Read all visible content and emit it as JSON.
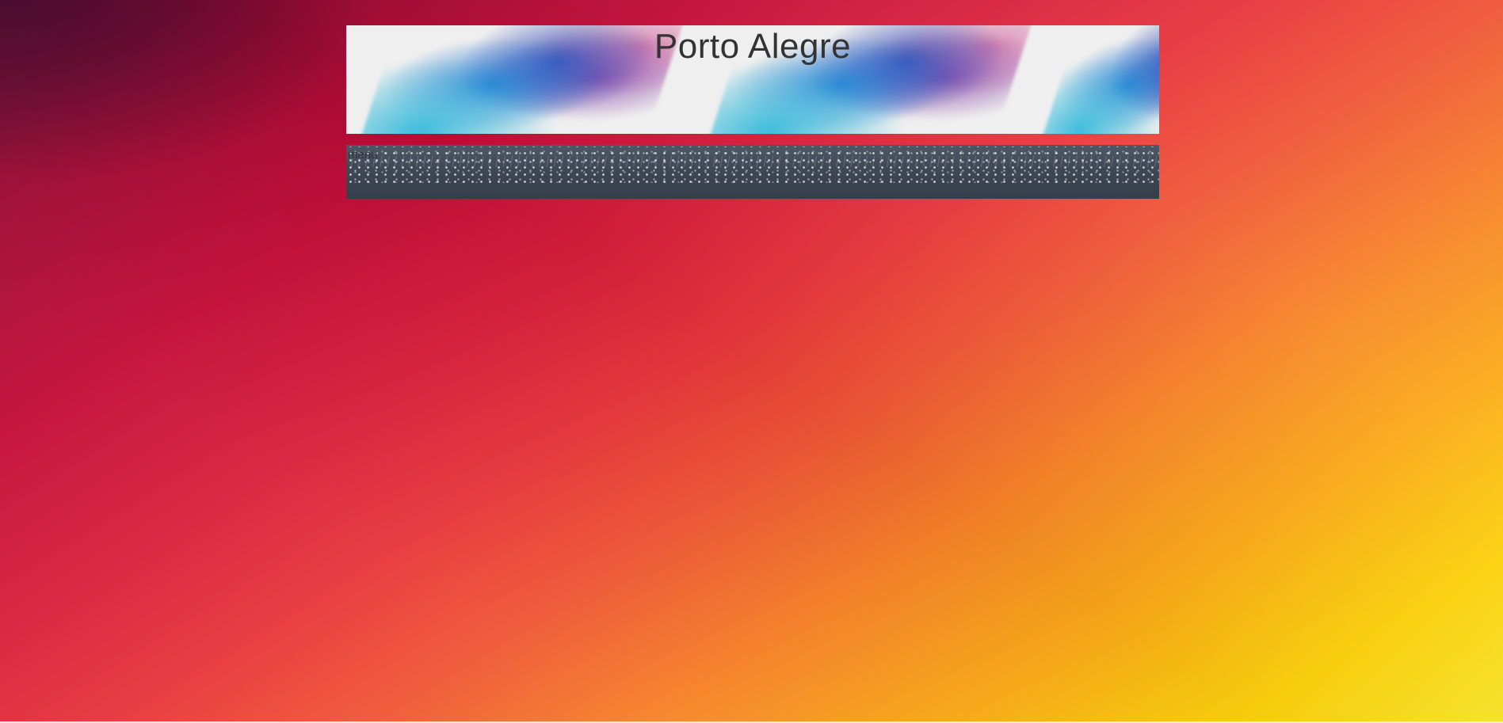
{
  "header": {
    "title": "Porto Alegre"
  },
  "nav": {
    "menu_label": "menu"
  },
  "colors": {
    "title_text": "#333333",
    "menu_bar": "#3e4855",
    "banner_bg": "#efefef"
  },
  "icons": {
    "banner_art": "watercolor-splash-pattern",
    "menu_art": "string-lights-pattern"
  }
}
